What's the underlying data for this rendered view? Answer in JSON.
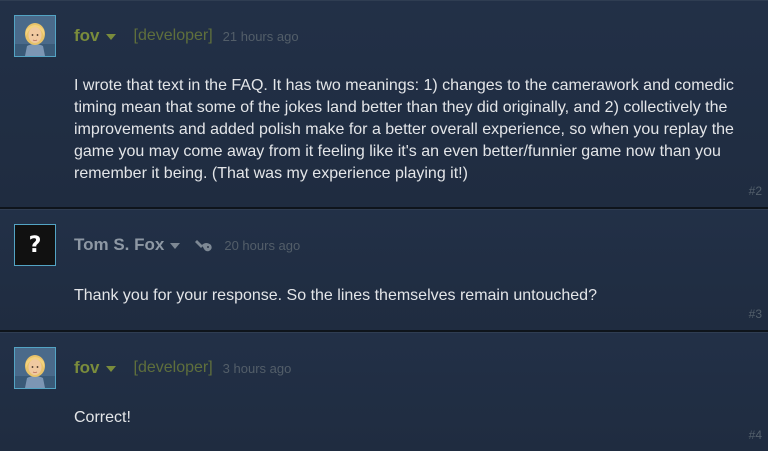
{
  "comments": [
    {
      "author": "fov",
      "role": "[developer]",
      "time": "21 hours ago",
      "body": "I wrote that text in the FAQ. It has two meanings: 1) changes to the camerawork and comedic timing mean that some of the jokes land better than they did originally, and 2) collectively the improvements and added polish make for a better overall experience, so when you replay the game you may come away from it feeling like it's an even better/funnier game now than you remember it being. (That was my experience playing it!)",
      "number": "#2"
    },
    {
      "author": "Tom S. Fox",
      "avatar_text": "?",
      "time": "20 hours ago",
      "body": "Thank you for your response. So the lines themselves remain untouched?",
      "number": "#3"
    },
    {
      "author": "fov",
      "role": "[developer]",
      "time": "3 hours ago",
      "body": "Correct!",
      "number": "#4"
    }
  ],
  "colors": {
    "developer_name": "#7a8c3c",
    "regular_name": "#8e98a4",
    "body_text": "#e3e5e8",
    "background": "#1b2838"
  },
  "icons": {
    "avatar_fov": "blonde-character-avatar",
    "device": "controller-icon"
  }
}
